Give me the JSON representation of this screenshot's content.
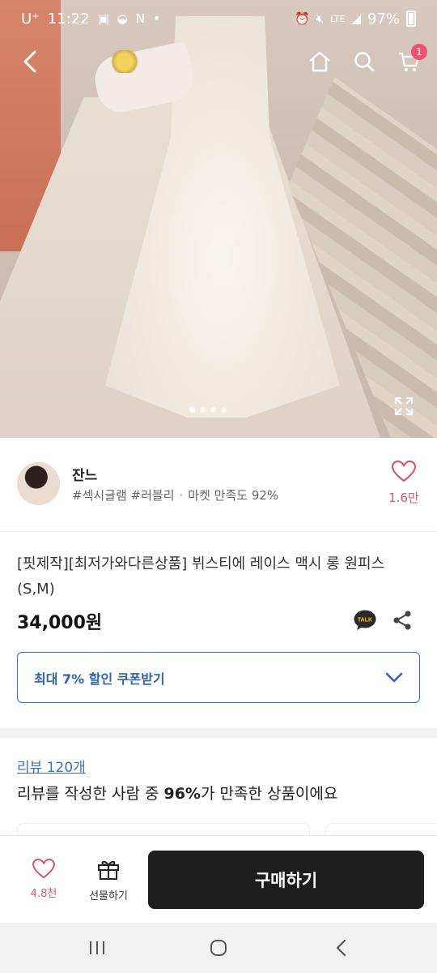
{
  "status_bar": {
    "carrier": "U⁺",
    "time": "11:22",
    "notification_letter": "N",
    "network": "LTE",
    "battery": "97%"
  },
  "nav": {
    "cart_count": "1",
    "image_page_count": 4,
    "active_image_index": 0
  },
  "seller": {
    "name": "잔느",
    "tags": "#섹시글램 #러블리",
    "satisfaction": "마켓 만족도 92%",
    "like_count": "1.6만"
  },
  "product": {
    "title": "[핏제작][최저가와다른상품] 뷔스티에 레이스 맥시 롱 원피스 (S,M)",
    "price": "34,000원",
    "talk_label": "TALK"
  },
  "coupon": {
    "label": "최대 7% 할인 쿠폰받기"
  },
  "review": {
    "link": "리뷰 120개",
    "summary_prefix": "리뷰를 작성한 사람 중 ",
    "summary_highlight": "96%",
    "summary_suffix": "가 만족한 상품이에요"
  },
  "actions": {
    "wish_count": "4.8천",
    "gift_label": "선물하기",
    "buy_label": "구매하기"
  },
  "colors": {
    "accent_blue": "#2e63ad",
    "heart_pink": "#d05a73",
    "buy_button": "#1e1e1e",
    "cart_badge": "#f0506e"
  }
}
